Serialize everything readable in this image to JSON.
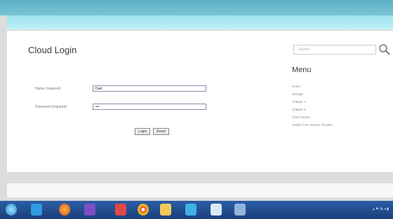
{
  "login": {
    "title": "Cloud Login",
    "name_label": "Name (required)",
    "name_value": "Dad",
    "password_label": "Password (required)",
    "password_value": "•••",
    "login_label": "Login",
    "reset_label": "Reset"
  },
  "sidebar": {
    "search_placeholder": "Search",
    "menu_title": "Menu",
    "items": [
      {
        "label": "Home"
      },
      {
        "label": "Storage"
      },
      {
        "label": "Chapter 4"
      },
      {
        "label": "Chapter 5"
      },
      {
        "label": "Cloud Server"
      },
      {
        "label": "Health Care Service Provider"
      }
    ]
  },
  "taskbar": {
    "icons": [
      "start-icon",
      "ie-icon",
      "firefox-icon",
      "visual-studio-icon",
      "paint-icon",
      "chrome-icon",
      "folder-icon",
      "network-icon",
      "media-icon",
      "window-icon"
    ],
    "tray_text": "▴ ⚑ ⁂ ◂ ▮"
  },
  "colors": {
    "header": "#79c4d4",
    "band": "#bdf0f7",
    "taskbar": "#1b3f7a"
  }
}
